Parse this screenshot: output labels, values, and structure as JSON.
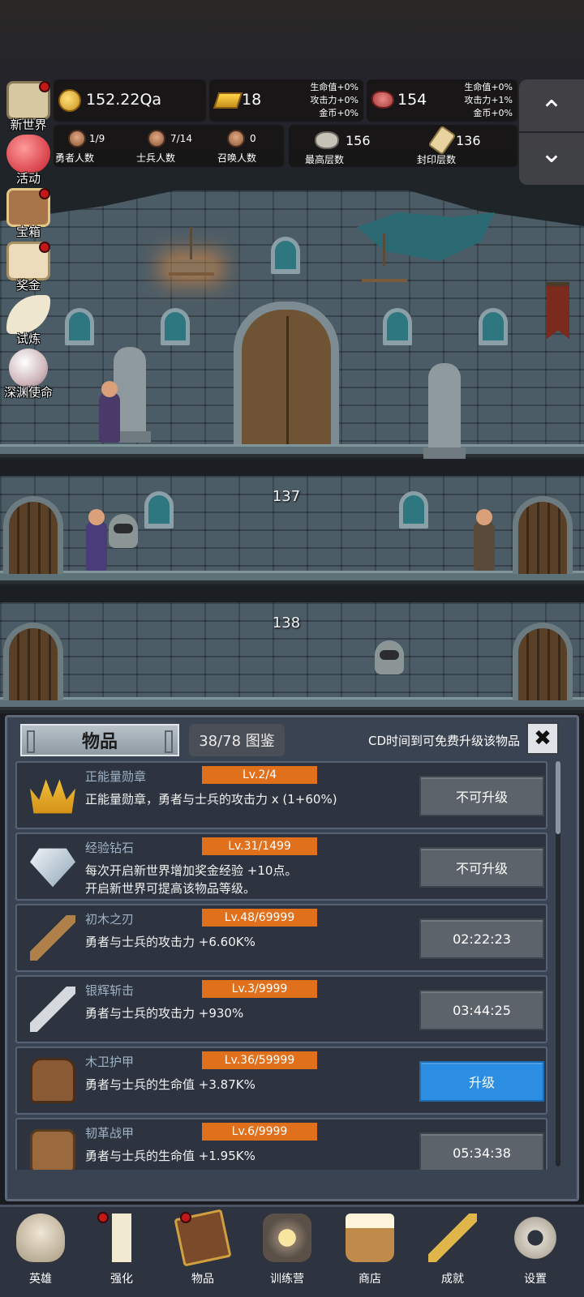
{
  "hud": {
    "coins": "152.22Qa",
    "gold": "18",
    "gold_bonus": [
      "生命值+0%",
      "攻击力+0%",
      "金币+0%"
    ],
    "meat": "154",
    "meat_bonus": [
      "生命值+0%",
      "攻击力+1%",
      "金币+0%"
    ],
    "heroes": {
      "value": "1/9",
      "label": "勇者人数"
    },
    "soldiers": {
      "value": "7/14",
      "label": "士兵人数"
    },
    "summons": {
      "value": "0",
      "label": "召唤人数"
    },
    "max_floor": {
      "value": "156",
      "label": "最高层数"
    },
    "sealed_floor": {
      "value": "136",
      "label": "封印层数"
    },
    "scroll_up": "⌃",
    "scroll_down": "⌄"
  },
  "side_menu": [
    {
      "label": "新世界",
      "icon": "map-icon",
      "badge": true
    },
    {
      "label": "活动",
      "icon": "heart-icon",
      "badge": false
    },
    {
      "label": "宝箱",
      "icon": "chest-icon",
      "badge": true
    },
    {
      "label": "奖金",
      "icon": "envelope-icon",
      "badge": true
    },
    {
      "label": "试炼",
      "icon": "feather-icon",
      "badge": false
    },
    {
      "label": "深渊使命",
      "icon": "pearl-icon",
      "badge": false
    }
  ],
  "scene": {
    "floor_a": "137",
    "floor_b": "138"
  },
  "panel": {
    "tab_title": "物品",
    "collection": "38/78 图鉴",
    "cd_hint": "CD时间到可免费升级该物品",
    "close": "✖"
  },
  "items": [
    {
      "name": "正能量勋章",
      "level": "Lv.2/4",
      "desc": "正能量勋章，勇者与士兵的攻击力 x (1+60%)",
      "action": "不可升级",
      "style": "gray",
      "icon": "crown-icon"
    },
    {
      "name": "经验钻石",
      "level": "Lv.31/1499",
      "desc": "每次开启新世界增加奖金经验 +10点。\n开启新世界可提高该物品等级。",
      "action": "不可升级",
      "style": "gray",
      "icon": "diamond-icon"
    },
    {
      "name": "初木之刃",
      "level": "Lv.48/69999",
      "desc": "勇者与士兵的攻击力 +6.60K%",
      "action": "02:22:23",
      "style": "gray",
      "icon": "wooden-sword-icon"
    },
    {
      "name": "银辉斩击",
      "level": "Lv.3/9999",
      "desc": "勇者与士兵的攻击力 +930%",
      "action": "03:44:25",
      "style": "gray",
      "icon": "silver-sword-icon"
    },
    {
      "name": "木卫护甲",
      "level": "Lv.36/59999",
      "desc": "勇者与士兵的生命值 +3.87K%",
      "action": "升级",
      "style": "blue",
      "icon": "armor-icon"
    },
    {
      "name": "韧革战甲",
      "level": "Lv.6/9999",
      "desc": "勇者与士兵的生命值 +1.95K%",
      "action": "05:34:38",
      "style": "gray",
      "icon": "leather-armor-icon"
    }
  ],
  "nav": [
    {
      "label": "英雄",
      "icon": "skull-icon",
      "badge": false
    },
    {
      "label": "强化",
      "icon": "candle-icon",
      "badge": true
    },
    {
      "label": "物品",
      "icon": "book-icon",
      "badge": true
    },
    {
      "label": "训练营",
      "icon": "lantern-icon",
      "badge": false
    },
    {
      "label": "商店",
      "icon": "mug-icon",
      "badge": false
    },
    {
      "label": "成就",
      "icon": "key-icon",
      "badge": false
    },
    {
      "label": "设置",
      "icon": "gear-icon",
      "badge": false
    }
  ]
}
